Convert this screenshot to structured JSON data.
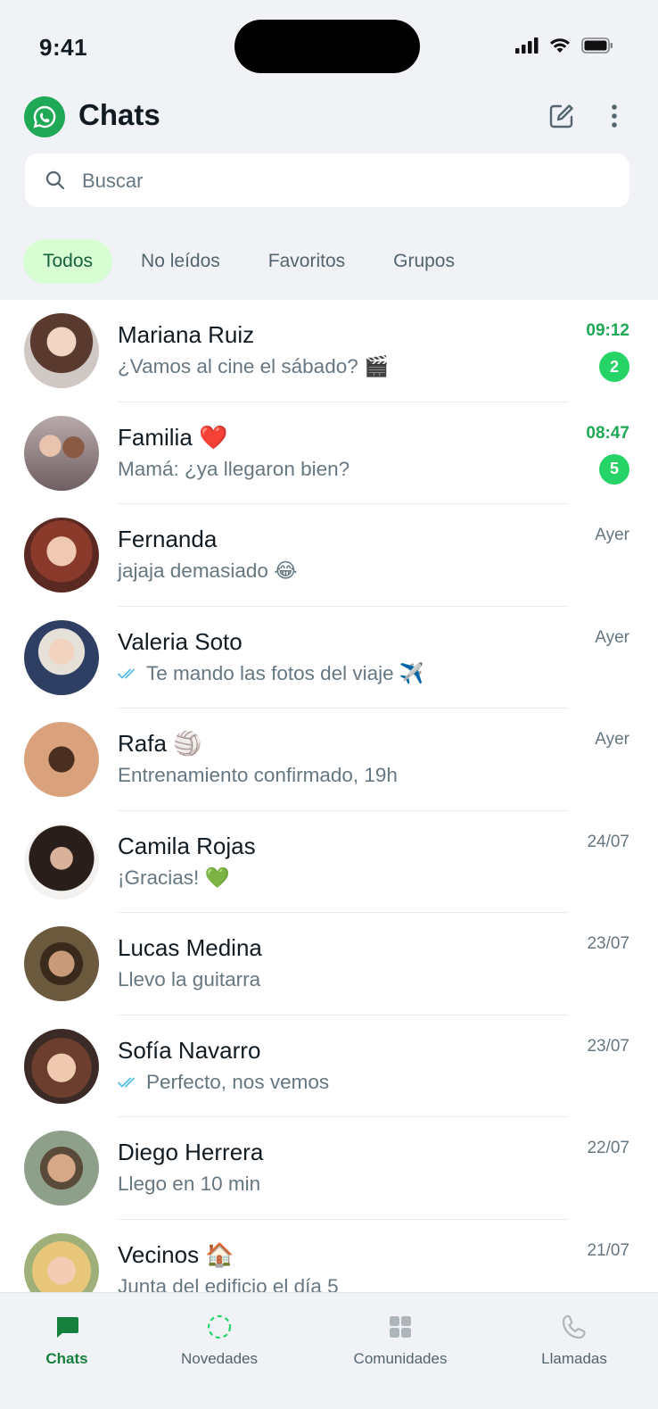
{
  "status": {
    "time": "9:41"
  },
  "header": {
    "title": "Chats"
  },
  "search": {
    "placeholder": "Buscar"
  },
  "filters": [
    "Todos",
    "No leídos",
    "Favoritos",
    "Grupos"
  ],
  "chats": [
    {
      "name": "Mariana Ruiz",
      "preview": "¿Vamos al cine el sábado? 🎬",
      "time": "09:12",
      "unread": "2",
      "read_ticks": false,
      "avatar_color": "#c9b5a8"
    },
    {
      "name": "Familia ❤️",
      "preview": "Mamá: ¿ya llegaron bien?",
      "time": "08:47",
      "unread": "5",
      "read_ticks": false,
      "avatar_color": "#9c8a8c"
    },
    {
      "name": "Fernanda",
      "preview": "jajaja demasiado 😂",
      "time": "Ayer",
      "unread": "",
      "read_ticks": false,
      "avatar_color": "#b06a52"
    },
    {
      "name": "Valeria Soto",
      "preview": "Te mando las fotos del viaje ✈️",
      "time": "Ayer",
      "unread": "",
      "read_ticks": true,
      "avatar_color": "#5b6c8a"
    },
    {
      "name": "Rafa 🏐",
      "preview": "Entrenamiento confirmado, 19h",
      "time": "Ayer",
      "unread": "",
      "read_ticks": false,
      "avatar_color": "#d9a27c"
    },
    {
      "name": "Camila Rojas",
      "preview": "¡Gracias! 💚",
      "time": "24/07",
      "unread": "",
      "read_ticks": false,
      "avatar_color": "#4a3a34"
    },
    {
      "name": "Lucas Medina",
      "preview": "Llevo la guitarra",
      "time": "23/07",
      "unread": "",
      "read_ticks": false,
      "avatar_color": "#5c4a33"
    },
    {
      "name": "Sofía Navarro",
      "preview": "Perfecto, nos vemos",
      "time": "23/07",
      "unread": "",
      "read_ticks": true,
      "avatar_color": "#6b4a44"
    },
    {
      "name": "Diego Herrera",
      "preview": "Llego en 10 min",
      "time": "22/07",
      "unread": "",
      "read_ticks": false,
      "avatar_color": "#7a8a6a"
    },
    {
      "name": "Vecinos 🏠",
      "preview": "Junta del edificio el día 5",
      "time": "21/07",
      "unread": "",
      "read_ticks": false,
      "avatar_color": "#d8b978"
    }
  ],
  "nav": [
    {
      "label": "Chats",
      "icon": "chat-bubble-icon",
      "active": true
    },
    {
      "label": "Novedades",
      "icon": "status-ring-icon",
      "active": false
    },
    {
      "label": "Comunidades",
      "icon": "communities-icon",
      "active": false
    },
    {
      "label": "Llamadas",
      "icon": "phone-icon",
      "active": false
    }
  ],
  "colors": {
    "accent": "#1fa855",
    "badge": "#25d366",
    "ticks": "#53bdeb"
  }
}
